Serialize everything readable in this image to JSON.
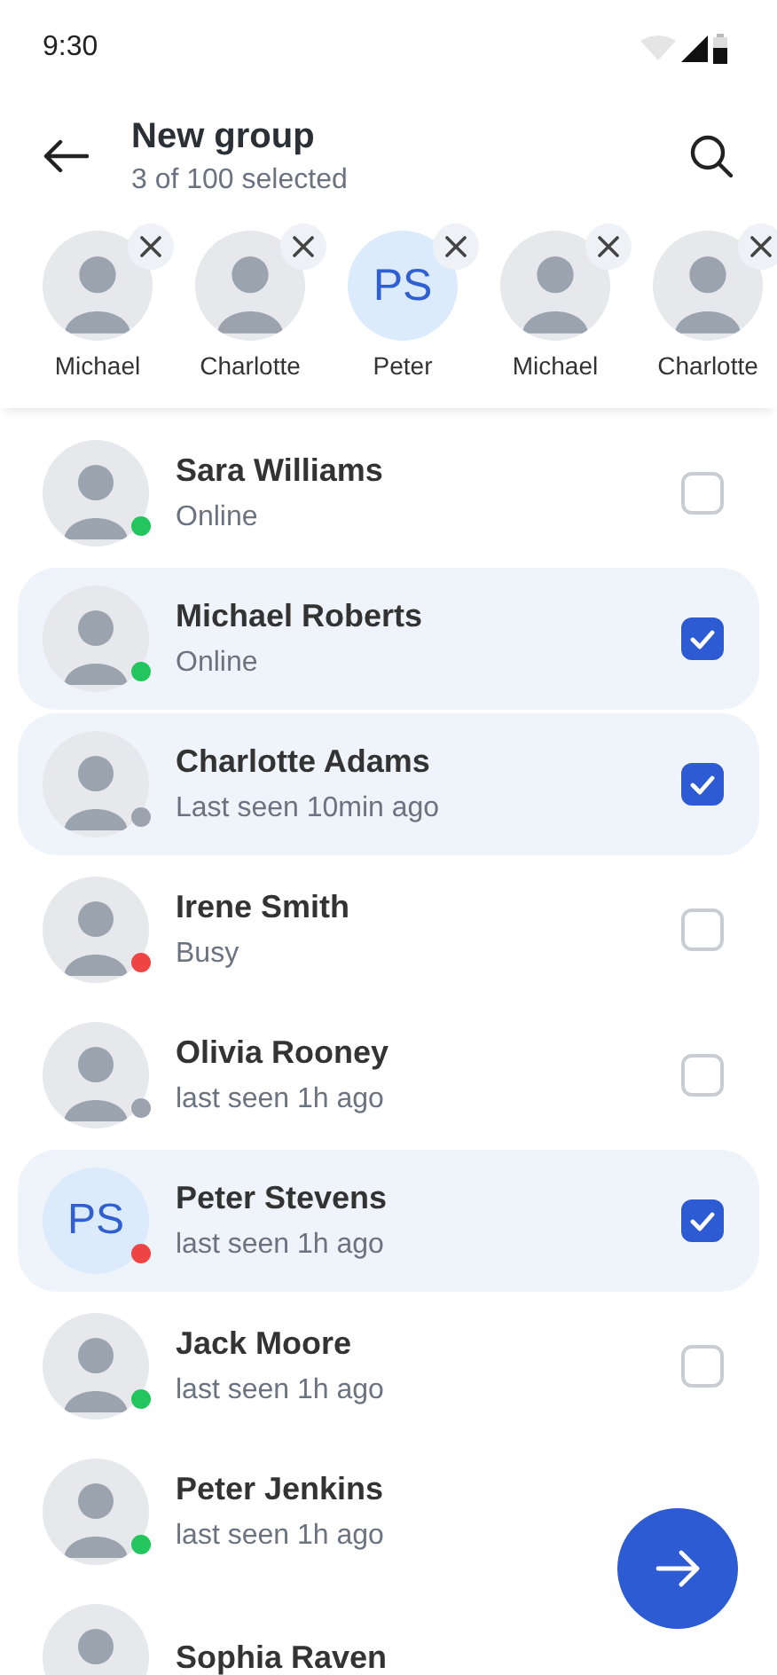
{
  "status_bar": {
    "time": "9:30"
  },
  "header": {
    "title": "New group",
    "subtitle": "3 of 100 selected"
  },
  "selected_contacts": [
    {
      "name": "Michael",
      "avatar": {
        "kind": "photo"
      }
    },
    {
      "name": "Charlotte",
      "avatar": {
        "kind": "photo"
      }
    },
    {
      "name": "Peter",
      "avatar": {
        "kind": "initials",
        "initials": "PS"
      }
    },
    {
      "name": "Michael",
      "avatar": {
        "kind": "photo"
      }
    },
    {
      "name": "Charlotte",
      "avatar": {
        "kind": "photo"
      }
    }
  ],
  "contacts": [
    {
      "name": "Sara Williams",
      "status": "Online",
      "color": "#22c55e",
      "checked": false,
      "avatar": {
        "kind": "photo"
      }
    },
    {
      "name": "Michael Roberts",
      "status": "Online",
      "color": "#22c55e",
      "checked": true,
      "avatar": {
        "kind": "photo"
      }
    },
    {
      "name": "Charlotte Adams",
      "status": "Last seen 10min ago",
      "color": "#9ca3af",
      "checked": true,
      "avatar": {
        "kind": "photo"
      }
    },
    {
      "name": "Irene Smith",
      "status": "Busy",
      "color": "#ef4444",
      "checked": false,
      "avatar": {
        "kind": "photo"
      }
    },
    {
      "name": "Olivia Rooney",
      "status": "last seen 1h ago",
      "color": "#9ca3af",
      "checked": false,
      "avatar": {
        "kind": "photo"
      }
    },
    {
      "name": "Peter Stevens",
      "status": "last seen 1h ago",
      "color": "#ef4444",
      "checked": true,
      "avatar": {
        "kind": "initials",
        "initials": "PS"
      }
    },
    {
      "name": "Jack Moore",
      "status": "last seen 1h ago",
      "color": "#22c55e",
      "checked": false,
      "avatar": {
        "kind": "photo"
      }
    },
    {
      "name": "Peter Jenkins",
      "status": "last seen 1h ago",
      "color": "#22c55e",
      "avatar": {
        "kind": "photo"
      }
    },
    {
      "name": "Sophia Raven",
      "avatar": {
        "kind": "photo"
      }
    }
  ]
}
